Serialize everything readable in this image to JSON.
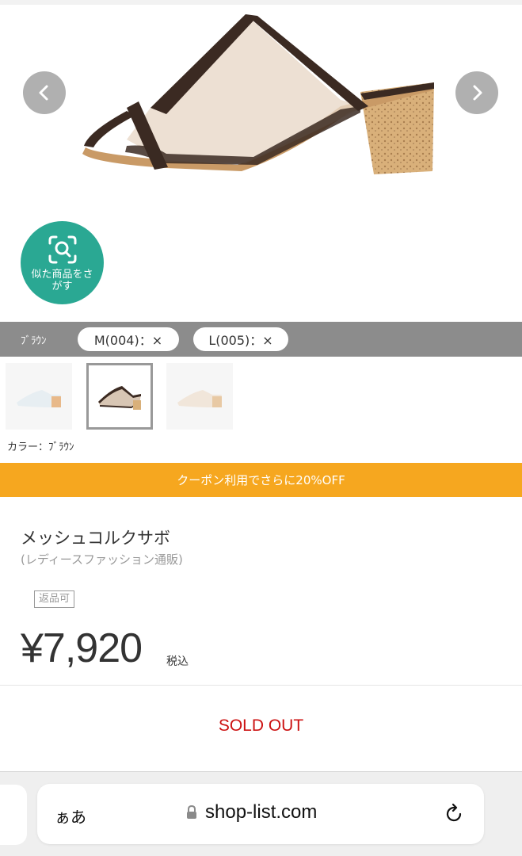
{
  "carousel": {
    "prev_icon": "chevron-left-icon",
    "next_icon": "chevron-right-icon"
  },
  "similar_search": {
    "icon": "image-search-icon",
    "label": "似た商品をさがす",
    "color": "#2aa893"
  },
  "size_bar": {
    "color_name": "ﾌﾞﾗｳﾝ",
    "sizes": [
      {
        "label": "M(004)：×"
      },
      {
        "label": "L(005)：×"
      }
    ]
  },
  "color_variants": {
    "caption": "カラー：ﾌﾞﾗｳﾝ",
    "selected_index": 1
  },
  "coupon": {
    "text": "クーポン利用でさらに20%OFF",
    "color": "#f6a71f"
  },
  "product": {
    "title": "メッシュコルクサボ",
    "subtitle": "(レディースファッション通販)",
    "return_badge": "返品可",
    "price": "¥7,920",
    "tax_label": "税込",
    "status": "SOLD OUT",
    "status_color": "#cc1111"
  },
  "browser": {
    "text_size_label": "ぁあ",
    "url": "shop-list.com",
    "lock_icon": "lock-icon",
    "reload_icon": "reload-icon"
  }
}
